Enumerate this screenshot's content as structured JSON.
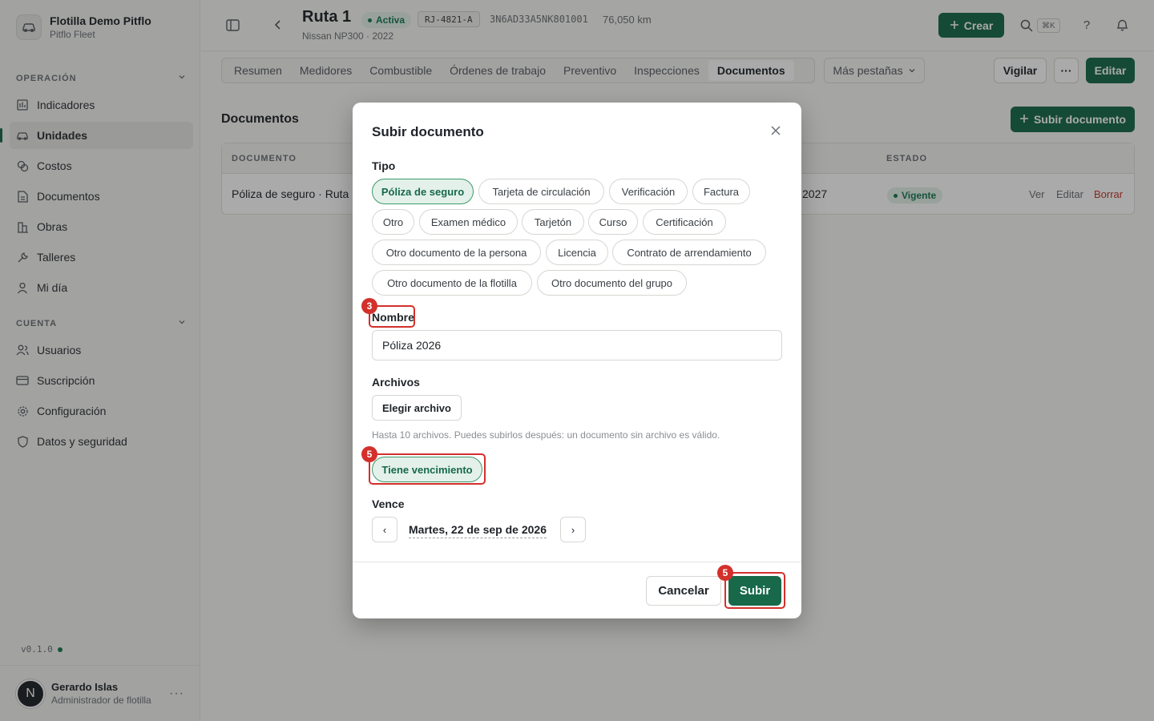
{
  "sidebar": {
    "org_name": "Flotilla Demo Pitflo",
    "org_sub": "Pitflo Fleet",
    "sections": [
      {
        "label": "OPERACIÓN",
        "items": [
          {
            "label": "Indicadores",
            "icon": "bars-chart-icon"
          },
          {
            "label": "Unidades",
            "icon": "car-icon",
            "active": true
          },
          {
            "label": "Costos",
            "icon": "coins-icon"
          },
          {
            "label": "Documentos",
            "icon": "document-icon"
          },
          {
            "label": "Obras",
            "icon": "buildings-icon"
          },
          {
            "label": "Talleres",
            "icon": "wrench-icon"
          },
          {
            "label": "Mi día",
            "icon": "person-icon"
          }
        ]
      },
      {
        "label": "CUENTA",
        "items": [
          {
            "label": "Usuarios",
            "icon": "users-icon"
          },
          {
            "label": "Suscripción",
            "icon": "credit-card-icon"
          },
          {
            "label": "Configuración",
            "icon": "gear-icon"
          },
          {
            "label": "Datos y seguridad",
            "icon": "shield-icon"
          }
        ]
      }
    ],
    "version": "v0.1.0",
    "user": {
      "initial": "N",
      "name": "Gerardo Islas",
      "role": "Administrador de flotilla"
    }
  },
  "header": {
    "title": "Ruta 1",
    "status": "Activa",
    "plate": "RJ-4821-A",
    "vin": "3N6AD33A5NK801001",
    "km": "76,050 km",
    "subtitle": "Nissan NP300 · 2022",
    "create_label": "Crear",
    "kbd": "⌘K",
    "help": "?"
  },
  "tabs": [
    "Resumen",
    "Medidores",
    "Combustible",
    "Órdenes de trabajo",
    "Preventivo",
    "Inspecciones",
    "Documentos"
  ],
  "active_tab": "Documentos",
  "more_tabs": "Más pestañas",
  "actions": {
    "watch": "Vigilar",
    "edit": "Editar"
  },
  "documents": {
    "title": "Documentos",
    "upload_label": "Subir documento",
    "columns": {
      "document": "DOCUMENTO",
      "status": "ESTADO"
    },
    "row": {
      "name": "Póliza de seguro · Ruta",
      "expires": "2027",
      "status": "Vigente",
      "view": "Ver",
      "edit": "Editar",
      "delete": "Borrar"
    }
  },
  "modal": {
    "title": "Subir documento",
    "type_label": "Tipo",
    "types": [
      "Póliza de seguro",
      "Tarjeta de circulación",
      "Verificación",
      "Factura",
      "Otro",
      "Examen médico",
      "Tarjetón",
      "Curso",
      "Certificación",
      "Otro documento de la persona",
      "Licencia",
      "Contrato de arrendamiento",
      "Otro documento de la flotilla",
      "Otro documento del grupo"
    ],
    "selected_type": "Póliza de seguro",
    "name_label": "Nombre",
    "name_value": "Póliza 2026",
    "files_label": "Archivos",
    "choose_file": "Elegir archivo",
    "files_hint": "Hasta 10 archivos. Puedes subirlos después: un documento sin archivo es válido.",
    "expiry_toggle": "Tiene vencimiento",
    "expires_label": "Vence",
    "date_value": "Martes, 22 de sep de 2026",
    "prev": "‹",
    "next": "›",
    "cancel": "Cancelar",
    "submit": "Subir"
  },
  "annotations": [
    {
      "step": "3",
      "target": "name-label"
    },
    {
      "step": "5",
      "target": "expiry-toggle"
    },
    {
      "step": "5",
      "target": "submit-button"
    }
  ],
  "colors": {
    "accent": "#17694a",
    "highlight": "#d3302b"
  }
}
